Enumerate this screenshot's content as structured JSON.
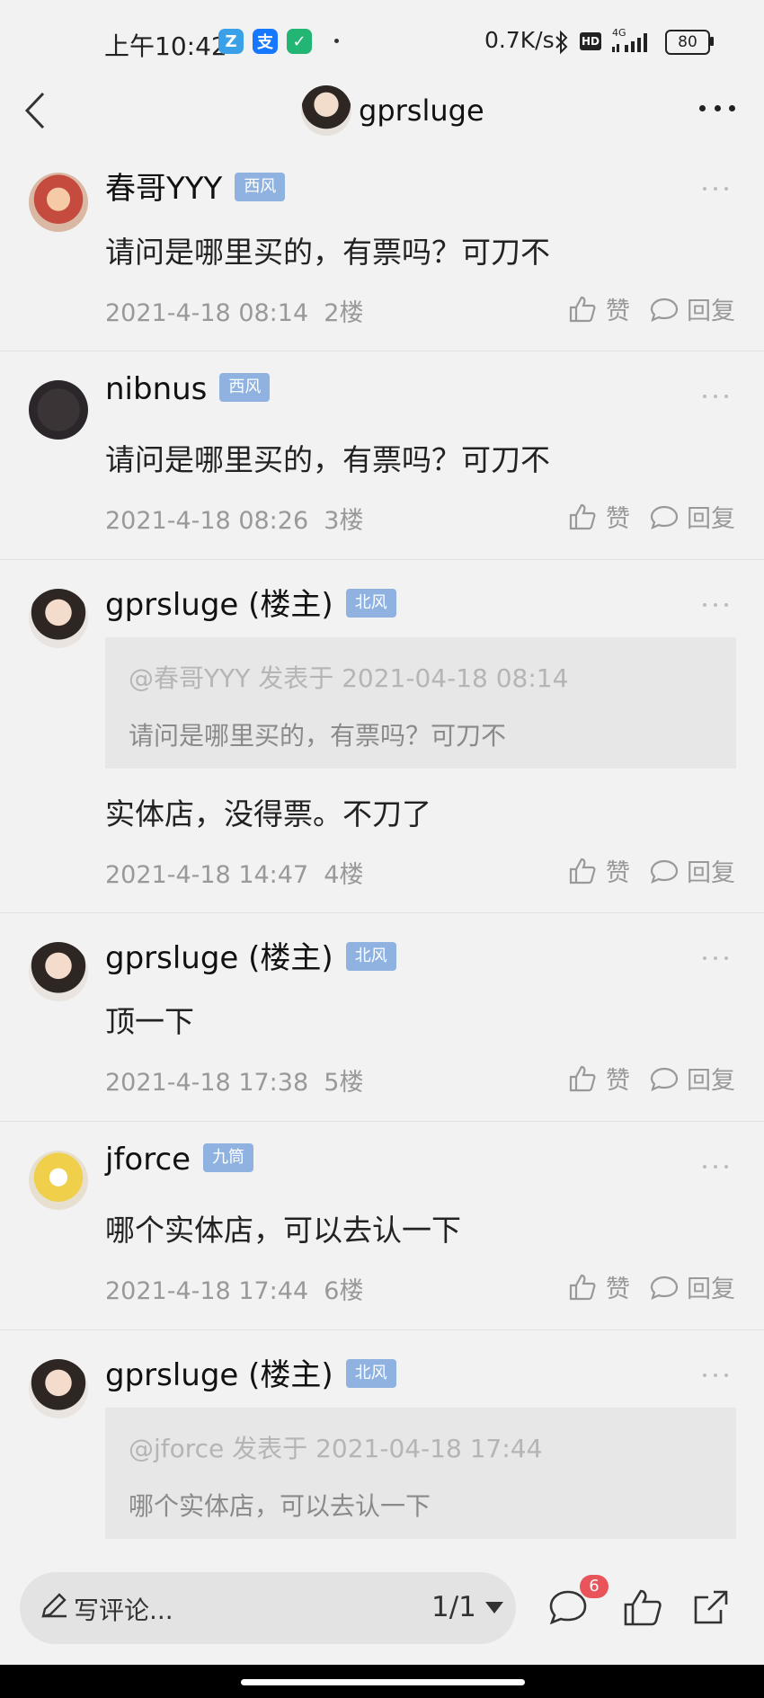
{
  "status_bar": {
    "time": "上午10:42",
    "apps": [
      {
        "name": "app-z-icon",
        "glyph": "Z",
        "color": "#3aa0e8"
      },
      {
        "name": "alipay-icon",
        "glyph": "支",
        "color": "#1677ff"
      },
      {
        "name": "shield-app-icon",
        "glyph": "⬢",
        "color": "#22b573"
      }
    ],
    "speed": "0.7K/s",
    "hd": "HD",
    "network": "4G",
    "battery": "80"
  },
  "header": {
    "title": "gprsluge"
  },
  "posts": [
    {
      "username": "春哥YYY",
      "badge": "西风",
      "content": "请问是哪里买的，有票吗？可刀不",
      "date": "2021-4-18 08:14",
      "floor": "2楼",
      "like_label": "赞",
      "reply_label": "回复"
    },
    {
      "username": "nibnus",
      "badge": "西风",
      "content": "请问是哪里买的，有票吗？可刀不",
      "date": "2021-4-18 08:26",
      "floor": "3楼",
      "like_label": "赞",
      "reply_label": "回复"
    },
    {
      "username": "gprsluge (楼主)",
      "badge": "北风",
      "quote_head": "@春哥YYY 发表于 2021-04-18 08:14",
      "quote_text": "请问是哪里买的，有票吗？可刀不",
      "content": "实体店，没得票。不刀了",
      "date": "2021-4-18 14:47",
      "floor": "4楼",
      "like_label": "赞",
      "reply_label": "回复"
    },
    {
      "username": "gprsluge (楼主)",
      "badge": "北风",
      "content": "顶一下",
      "date": "2021-4-18 17:38",
      "floor": "5楼",
      "like_label": "赞",
      "reply_label": "回复"
    },
    {
      "username": "jforce",
      "badge": "九筒",
      "content": "哪个实体店，可以去认一下",
      "date": "2021-4-18 17:44",
      "floor": "6楼",
      "like_label": "赞",
      "reply_label": "回复"
    },
    {
      "username": "gprsluge (楼主)",
      "badge": "北风",
      "quote_head": "@jforce 发表于 2021-04-18 17:44",
      "quote_text": "哪个实体店，可以去认一下"
    }
  ],
  "bottom_bar": {
    "input_placeholder": "写评论...",
    "page_indicator": "1/1",
    "comment_count": "6"
  },
  "colors": {
    "badge_bg": "#8fb2e0",
    "comment_badge": "#e9545b",
    "background": "#f2f2f2"
  }
}
